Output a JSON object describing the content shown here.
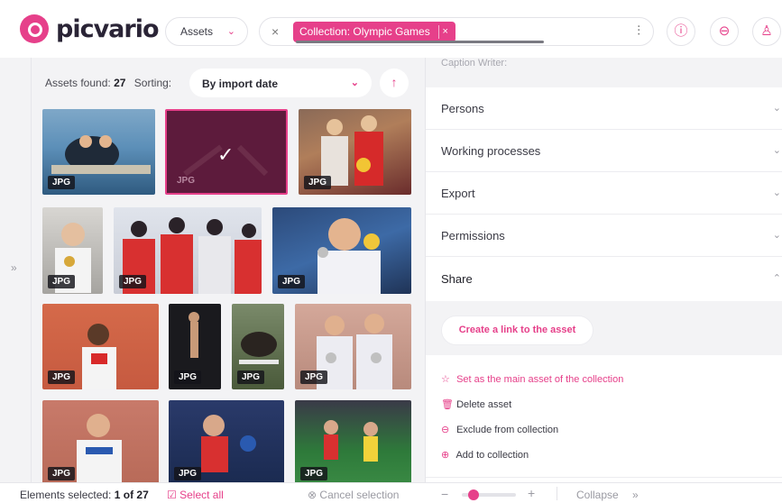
{
  "header": {
    "logo_text": "picvario",
    "scope_select": "Assets",
    "search_chip": "Collection: Olympic Games",
    "clear_icon": "×",
    "chip_close_icon": "×",
    "filter_icon": "⫶",
    "info_icon": "ⓘ",
    "inbox_icon": "⊖",
    "user_icon": "♙"
  },
  "rail": {
    "expand_icon": "»"
  },
  "assets": {
    "found_label": "Assets found:",
    "found_count": "27",
    "sorting_label": "Sorting:",
    "sorting_value": "By import date",
    "sort_direction_icon": "↑",
    "check_icon": "✓",
    "thumbnails": [
      {
        "format": "JPG",
        "selected": false
      },
      {
        "format": "JPG",
        "selected": true
      },
      {
        "format": "JPG",
        "selected": false
      },
      {
        "format": "JPG",
        "selected": false
      },
      {
        "format": "JPG",
        "selected": false
      },
      {
        "format": "JPG",
        "selected": false
      },
      {
        "format": "JPG",
        "selected": false
      },
      {
        "format": "JPG",
        "selected": false
      },
      {
        "format": "JPG",
        "selected": false
      },
      {
        "format": "JPG",
        "selected": false
      },
      {
        "format": "JPG",
        "selected": false
      },
      {
        "format": "JPG",
        "selected": false
      },
      {
        "format": "JPG",
        "selected": false
      }
    ]
  },
  "right_panel": {
    "caption_writer_label": "Caption Writer:",
    "sections": [
      {
        "label": "Persons",
        "icon": "⌄"
      },
      {
        "label": "Working processes",
        "icon": "⌄"
      },
      {
        "label": "Export",
        "icon": "⌄"
      },
      {
        "label": "Permissions",
        "icon": "⌄"
      },
      {
        "label": "Share",
        "icon": "⌃"
      }
    ],
    "create_link_button": "Create a link to the asset",
    "actions": [
      {
        "label": "Set as the main asset of the collection",
        "icon": "☆"
      },
      {
        "label": "Delete asset",
        "icon": "🗑"
      },
      {
        "label": "Exclude from collection",
        "icon": "⊖"
      },
      {
        "label": "Add to collection",
        "icon": "⊕"
      }
    ]
  },
  "footer": {
    "elements_selected_label": "Elements selected:",
    "elements_selected_value": "1 of 27",
    "select_all": "Select all",
    "select_all_icon": "☑",
    "cancel_selection": "Cancel selection",
    "cancel_icon": "⊗",
    "zoom_minus": "−",
    "zoom_plus": "+",
    "zoom_level": 0.15,
    "collapse_label": "Collapse",
    "collapse_icon": "»"
  },
  "colors": {
    "accent": "#e6408a",
    "panel_bg": "#f3f3f5"
  }
}
